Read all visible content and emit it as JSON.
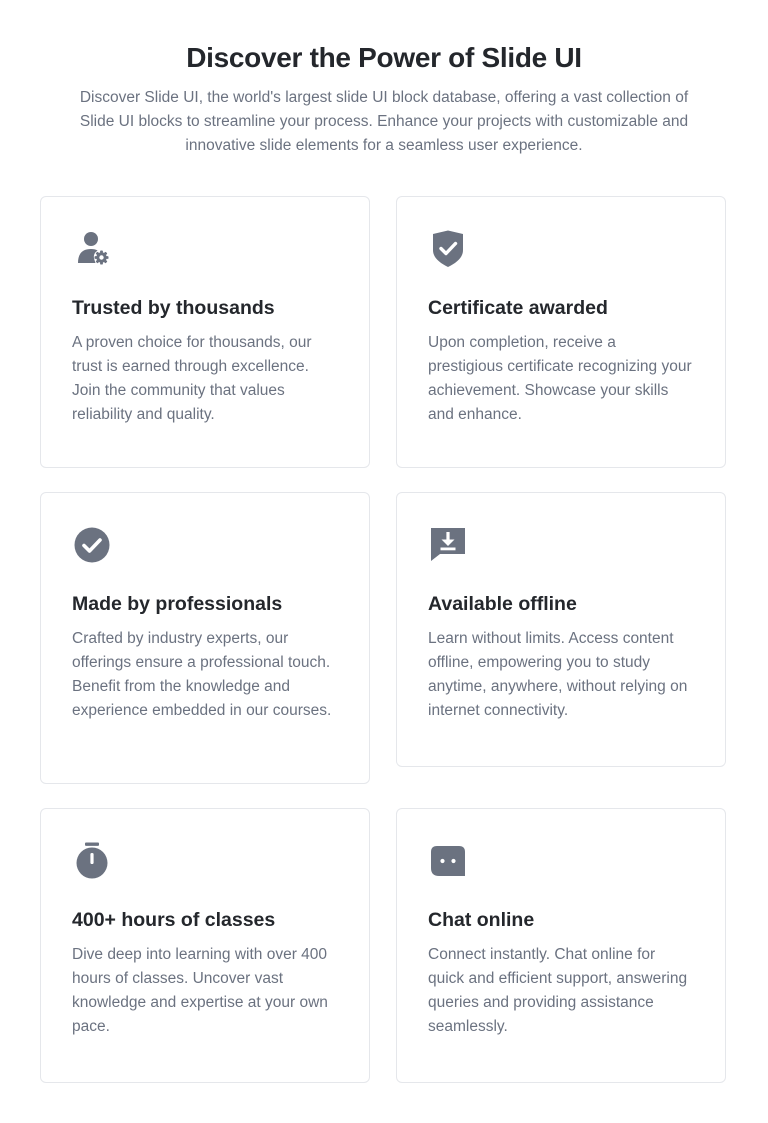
{
  "header": {
    "title": "Discover the Power of Slide UI",
    "description": "Discover Slide UI, the world's largest slide UI block database, offering a vast collection of Slide UI blocks to streamline your process. Enhance your projects with customizable and innovative slide elements for a seamless user experience."
  },
  "icon_color": "#6b7280",
  "features": [
    {
      "icon": "user-gear-icon",
      "title": "Trusted by thousands",
      "text": "A proven choice for thousands, our trust is earned through excellence. Join the community that values reliability and quality."
    },
    {
      "icon": "shield-check-icon",
      "title": "Certificate awarded",
      "text": "Upon completion, receive a prestigious certificate recognizing your achievement. Showcase your skills and enhance."
    },
    {
      "icon": "check-circle-icon",
      "title": "Made by professionals",
      "text": "Crafted by industry experts, our offerings ensure a professional touch. Benefit from the knowledge and experience embedded in our courses."
    },
    {
      "icon": "download-message-icon",
      "title": "Available offline",
      "text": "Learn without limits. Access content offline, empowering you to study anytime, anywhere, without relying on internet connectivity."
    },
    {
      "icon": "stopwatch-icon",
      "title": "400+ hours of classes",
      "text": "Dive deep into learning with over 400 hours of classes. Uncover vast knowledge and expertise at your own pace."
    },
    {
      "icon": "chat-bot-icon",
      "title": "Chat online",
      "text": "Connect instantly. Chat online for quick and efficient support, answering queries and providing assistance seamlessly."
    }
  ]
}
